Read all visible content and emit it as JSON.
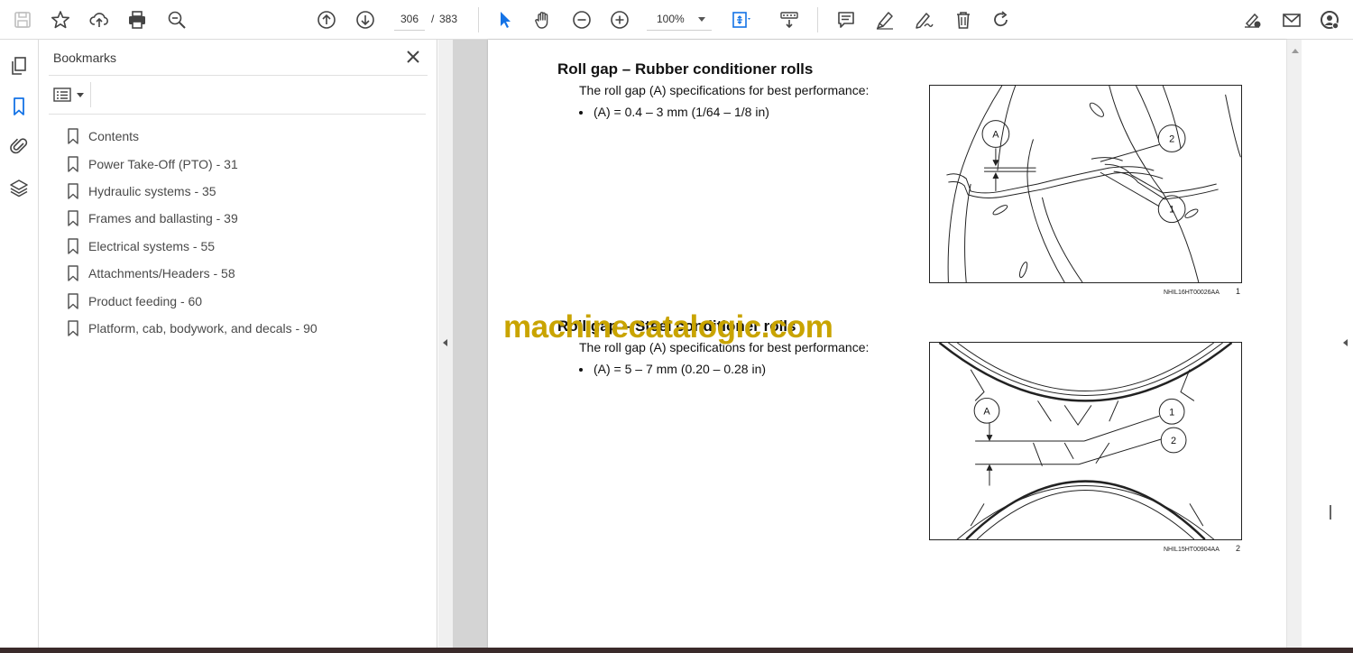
{
  "toolbar": {
    "page_current": "306",
    "page_separator": "/",
    "page_total": "383",
    "zoom": "100%"
  },
  "panel": {
    "title": "Bookmarks",
    "items": [
      {
        "label": "Contents"
      },
      {
        "label": "Power Take-Off (PTO) - 31"
      },
      {
        "label": "Hydraulic systems - 35"
      },
      {
        "label": "Frames and ballasting - 39"
      },
      {
        "label": "Electrical systems - 55"
      },
      {
        "label": "Attachments/Headers - 58"
      },
      {
        "label": "Product feeding - 60"
      },
      {
        "label": "Platform, cab, bodywork, and decals - 90"
      }
    ]
  },
  "document": {
    "section1": {
      "heading": "Roll gap – Rubber conditioner rolls",
      "intro": "The roll gap (A) specifications for best performance:",
      "bullet": "(A) = 0.4 – 3 mm (1/64 – 1/8 in)",
      "figure": {
        "callouts": [
          "A",
          "2",
          "1"
        ],
        "code": "NHIL16HT00026AA",
        "number": "1"
      }
    },
    "section2": {
      "heading": "Roll gap – Steel conditioner rolls",
      "intro": "The roll gap (A) specifications for best performance:",
      "bullet": "(A) = 5 – 7 mm (0.20 – 0.28 in)",
      "figure": {
        "callouts": [
          "A",
          "1",
          "2"
        ],
        "code": "NHIL15HT00904AA",
        "number": "2"
      }
    },
    "watermark": "machinecatalogic.com"
  }
}
